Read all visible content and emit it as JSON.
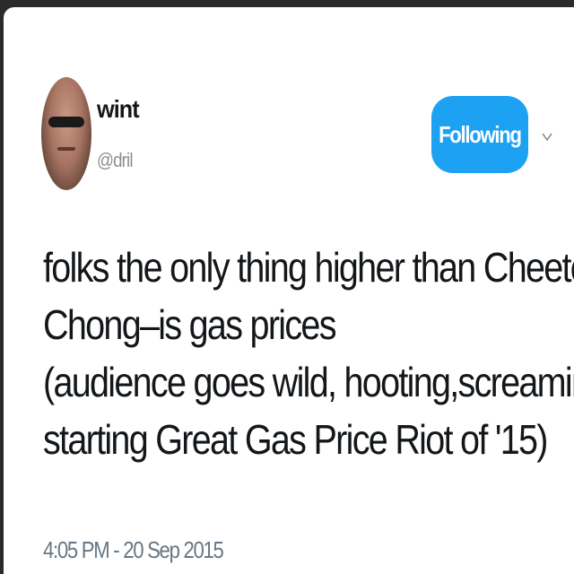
{
  "author": {
    "name": "wint",
    "handle": "@dril"
  },
  "follow_button": {
    "label": "Following"
  },
  "menu_icon": "chevron-down-icon",
  "tweet": {
    "lines": [
      "folks the only thing higher than Cheetch &",
      "Chong–is gas prices",
      "(audience goes wild, hooting,screaming;",
      "starting Great Gas Price Riot of '15)"
    ],
    "timestamp": "4:05 PM - 20 Sep 2015"
  },
  "colors": {
    "accent": "#1da1f2",
    "text": "#14171a",
    "muted": "#657786"
  }
}
